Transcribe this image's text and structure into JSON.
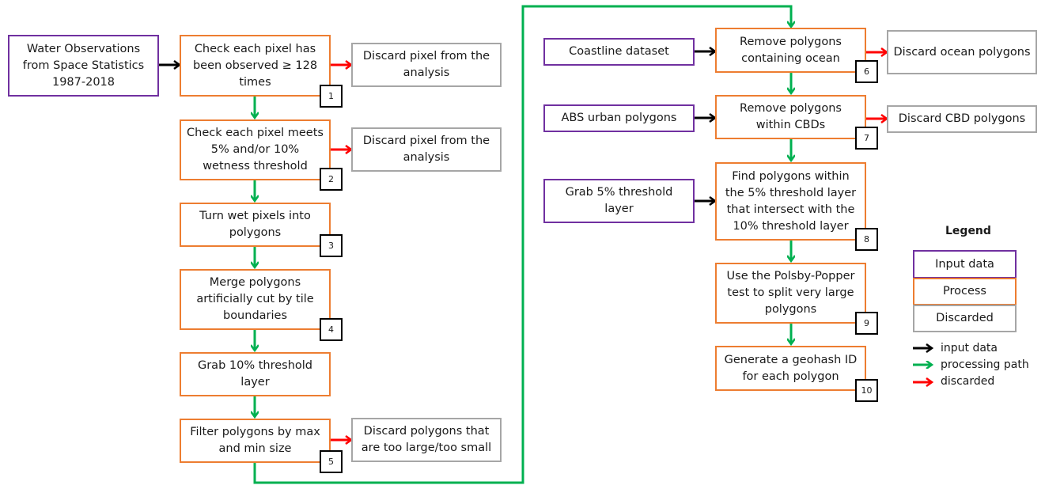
{
  "inputs": {
    "wofs": "Water Observations from Space Statistics 1987-2018",
    "coastline": "Coastline dataset",
    "abs_urban": "ABS urban polygons",
    "grab5": "Grab 5% threshold layer"
  },
  "steps": [
    {
      "num": "1",
      "label": "Check each pixel has been observed ≥ 128 times"
    },
    {
      "num": "2",
      "label": "Check each pixel meets 5% and/or 10% wetness threshold"
    },
    {
      "num": "3",
      "label": "Turn wet pixels into polygons"
    },
    {
      "num": "4",
      "label": "Merge polygons artificially cut by tile boundaries"
    },
    {
      "num": "",
      "label": "Grab 10% threshold layer"
    },
    {
      "num": "5",
      "label": "Filter polygons by max and min size"
    },
    {
      "num": "6",
      "label": "Remove polygons containing ocean"
    },
    {
      "num": "7",
      "label": "Remove polygons within CBDs"
    },
    {
      "num": "8",
      "label": "Find polygons within the 5% threshold layer that intersect with the 10% threshold layer"
    },
    {
      "num": "9",
      "label": "Use the Polsby-Popper test to split very large polygons"
    },
    {
      "num": "10",
      "label": "Generate a geohash ID for each polygon"
    }
  ],
  "discards": {
    "d1": "Discard pixel from the analysis",
    "d2": "Discard pixel from the analysis",
    "d5": "Discard polygons that are too large/too small",
    "d6": "Discard ocean polygons",
    "d7": "Discard CBD polygons"
  },
  "legend": {
    "title": "Legend",
    "boxes": [
      "Input data",
      "Process",
      "Discarded"
    ],
    "arrows": [
      "input data",
      "processing path",
      "discarded"
    ]
  },
  "colors": {
    "input": "#7030a0",
    "process": "#ed7d31",
    "discard": "#a6a6a6",
    "arrow_input": "#000000",
    "arrow_process": "#00b050",
    "arrow_discard": "#ff0000"
  }
}
